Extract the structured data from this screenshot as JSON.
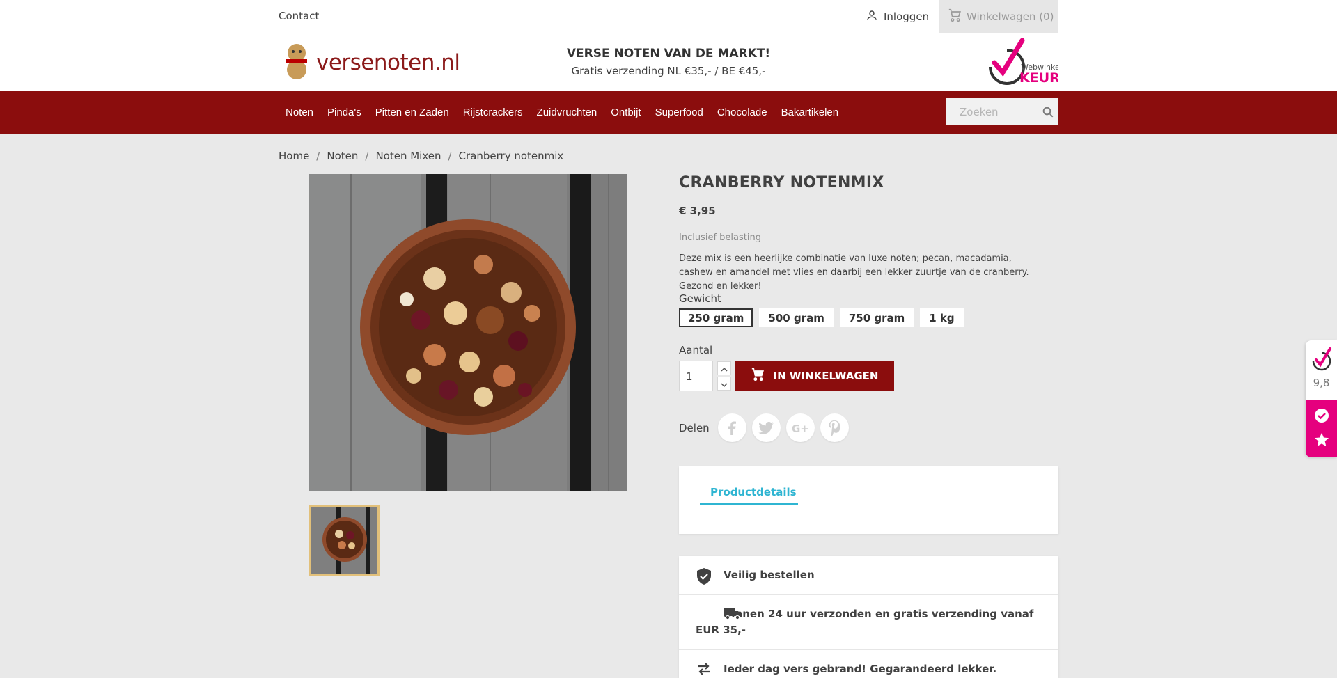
{
  "topbar": {
    "contact": "Contact",
    "login": "Inloggen",
    "cart": "Winkelwagen (0)"
  },
  "header": {
    "logo_text": "versenoten.nl",
    "promo_title": "VERSE NOTEN VAN DE MARKT!",
    "promo_sub": "Gratis verzending NL €35,- / BE €45,-",
    "keur_top": "Webwinkel",
    "keur_brand": "KEUR"
  },
  "nav": {
    "items": [
      "Noten",
      "Pinda's",
      "Pitten en Zaden",
      "Rijstcrackers",
      "Zuidvruchten",
      "Ontbijt",
      "Superfood",
      "Chocolade",
      "Bakartikelen"
    ],
    "search_placeholder": "Zoeken"
  },
  "breadcrumb": [
    "Home",
    "Noten",
    "Noten Mixen",
    "Cranberry notenmix"
  ],
  "product": {
    "name": "CRANBERRY NOTENMIX",
    "price": "€ 3,95",
    "tax_label": "Inclusief belasting",
    "description": "Deze mix is een heerlijke combinatie van luxe noten; pecan, macadamia, cashew en amandel met vlies en daarbij een lekker zuurtje van de cranberry. Gezond en lekker!",
    "weight_label": "Gewicht",
    "weights": [
      "250 gram",
      "500 gram",
      "750 gram",
      "1 kg"
    ],
    "selected_weight": "250 gram",
    "quantity_label": "Aantal",
    "quantity": "1",
    "add_to_cart": "IN WINKELWAGEN",
    "share_label": "Delen",
    "share_icons": [
      "facebook-icon",
      "twitter-icon",
      "google-plus-icon",
      "pinterest-icon"
    ]
  },
  "tabs": {
    "active": "Productdetails"
  },
  "reassurance": [
    {
      "icon": "shield-check-icon",
      "text": "Veilig bestellen"
    },
    {
      "icon": "truck-icon",
      "text": "Binnen 24 uur verzonden en gratis verzending vanaf EUR 35,-"
    },
    {
      "icon": "swap-arrows-icon",
      "text": "Ieder dag vers gebrand! Gegarandeerd lekker."
    }
  ],
  "widget": {
    "score": "9,8"
  },
  "colors": {
    "brand_red": "#8b0d0d",
    "accent_blue": "#2fb5d2",
    "keur_pink": "#e5007e"
  }
}
